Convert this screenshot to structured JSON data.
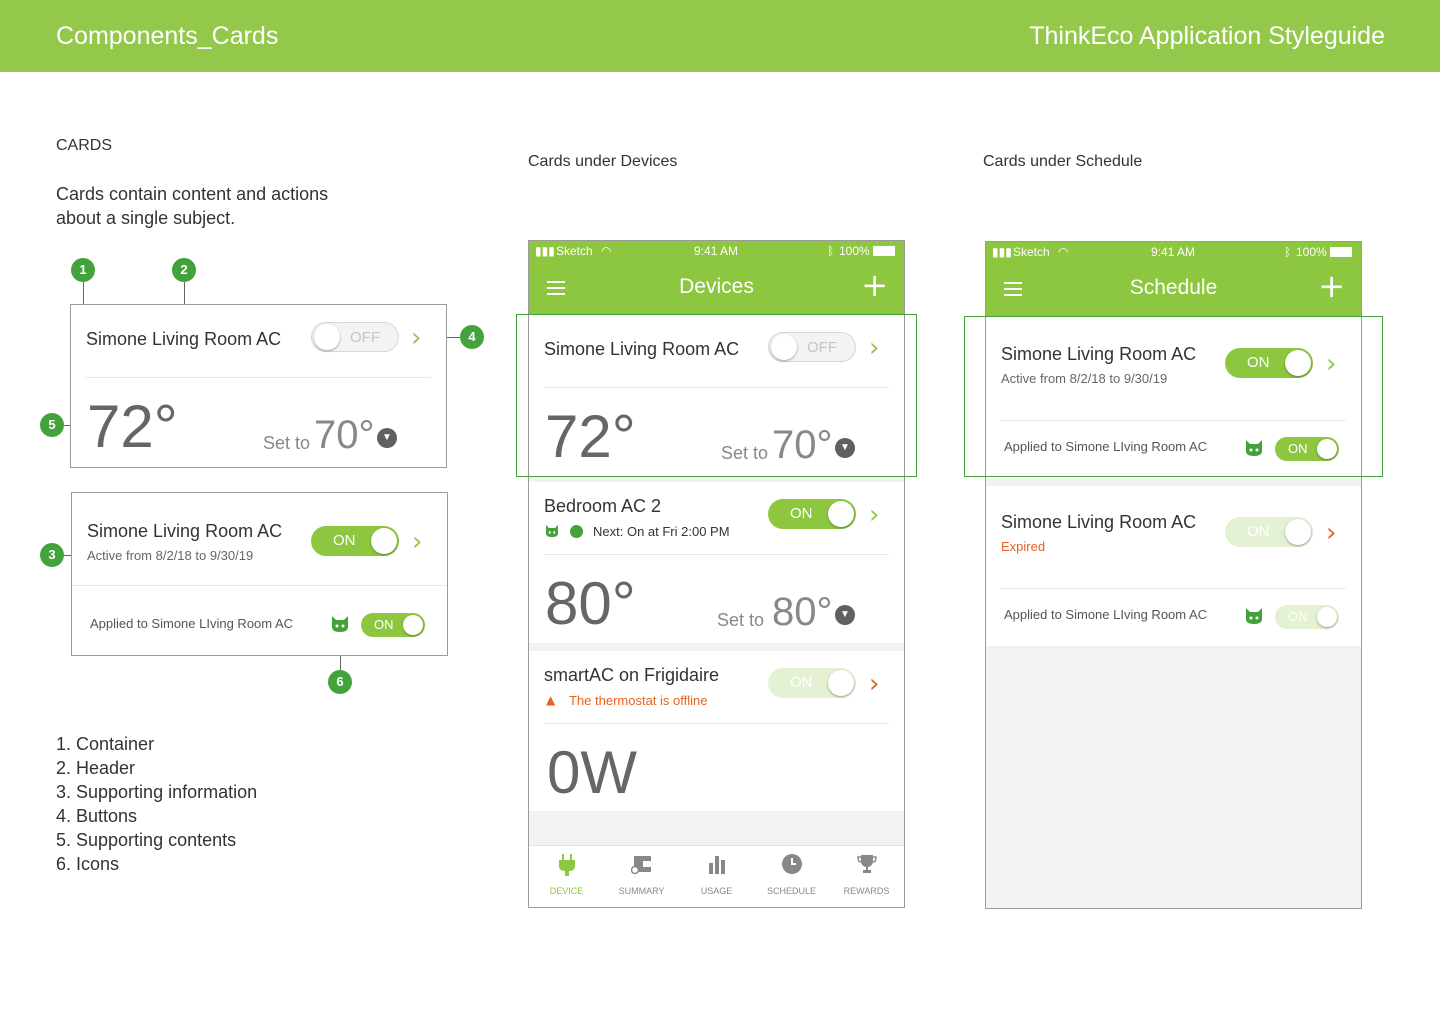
{
  "header": {
    "left_title": "Components_Cards",
    "right_title": "ThinkEco Application Styleguide"
  },
  "left": {
    "section": "CARDS",
    "description": "Cards contain content and actions about a single subject.",
    "markers": [
      "1",
      "2",
      "3",
      "4",
      "5",
      "6"
    ],
    "card1": {
      "name": "Simone Living Room AC",
      "toggle": "OFF",
      "temp": "72°",
      "set_to": "Set to",
      "set_val": "70°"
    },
    "card2": {
      "name": "Simone Living Room AC",
      "sub": "Active from 8/2/18 to 9/30/19",
      "toggle": "ON",
      "applied": "Applied to Simone LIving Room AC",
      "applied_toggle": "ON"
    },
    "legend": [
      "1. Container",
      "2. Header",
      "3. Supporting information",
      "4. Buttons",
      "5. Supporting contents",
      "6. Icons"
    ]
  },
  "devices": {
    "section": "Cards under Devices",
    "status": {
      "carrier": "Sketch",
      "time": "9:41 AM",
      "battery": "100%"
    },
    "title": "Devices",
    "cards": [
      {
        "name": "Simone Living Room AC",
        "toggle": "OFF",
        "temp": "72°",
        "set_to": "Set to",
        "set_val": "70°"
      },
      {
        "name": "Bedroom AC 2",
        "sub": "Next: On at Fri 2:00 PM",
        "toggle": "ON",
        "temp": "80°",
        "set_to": "Set to",
        "set_val": "80°"
      },
      {
        "name": "smartAC on Frigidaire",
        "sub": "The thermostat is offline",
        "toggle": "ON",
        "temp": "0W"
      }
    ],
    "tabs": [
      "DEVICE",
      "SUMMARY",
      "USAGE",
      "SCHEDULE",
      "REWARDS"
    ]
  },
  "schedule": {
    "section": "Cards under Schedule",
    "status": {
      "carrier": "Sketch",
      "time": "9:41 AM",
      "battery": "100%"
    },
    "title": "Schedule",
    "cards": [
      {
        "name": "Simone Living Room AC",
        "sub": "Active from 8/2/18 to 9/30/19",
        "toggle": "ON",
        "applied": "Applied to Simone LIving Room AC",
        "applied_toggle": "ON"
      },
      {
        "name": "Simone Living Room AC",
        "sub": "Expired",
        "toggle": "ON",
        "applied": "Applied to Simone LIving Room AC",
        "applied_toggle": "ON"
      }
    ]
  },
  "colors": {
    "brand_green": "#94c84b",
    "marker_green": "#43a23c",
    "warning_orange": "#e8631e"
  }
}
